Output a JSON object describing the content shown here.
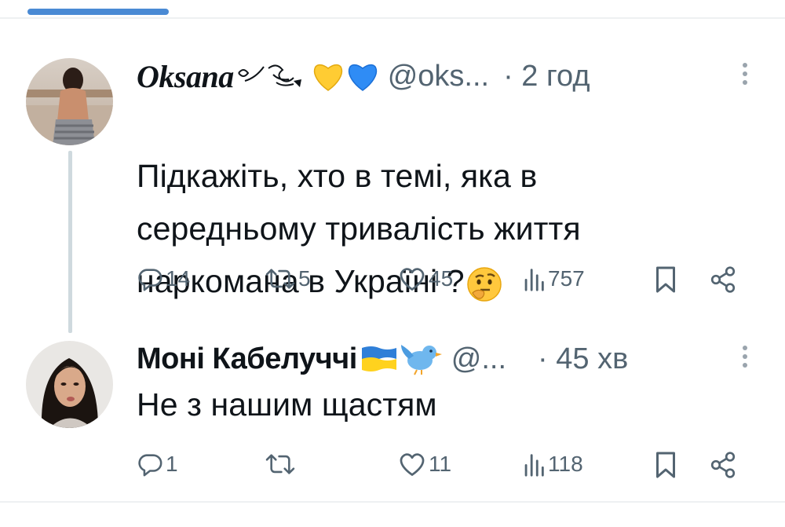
{
  "tweets": [
    {
      "display_name": "Oksana",
      "handle": "@oks...",
      "time": "· 2 год",
      "text": "Підкажіть, хто в темі, яка в\nсередньому тривалість життя\nнаркомана в Україні ?",
      "trailing_emoji": "thinking-face",
      "actions": {
        "replies": "14",
        "reposts": "5",
        "likes": "45",
        "views": "757"
      }
    },
    {
      "display_name": "Моні Кабелуччі",
      "handle": "@...",
      "time": "· 45 хв",
      "text": "Не з нашим щастям",
      "name_emojis": [
        "ukraine-flag",
        "bird"
      ],
      "actions": {
        "replies": "1",
        "reposts": "",
        "likes": "11",
        "views": "118"
      }
    }
  ],
  "icons": {
    "reply": "reply-icon",
    "repost": "repost-icon",
    "like": "heart-icon",
    "views": "views-icon",
    "bookmark": "bookmark-icon",
    "share": "share-icon",
    "more": "more-icon"
  },
  "colors": {
    "accent": "#4a8ad4",
    "muted": "#536471",
    "text": "#0f1419",
    "thread": "#cfd9de"
  }
}
